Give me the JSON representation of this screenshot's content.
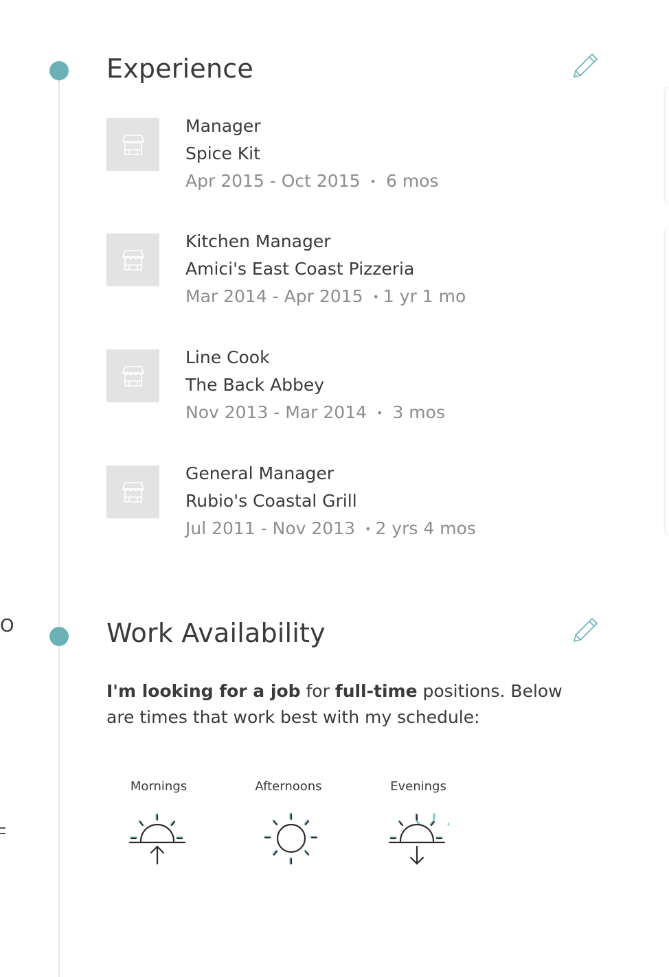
{
  "experience": {
    "title": "Experience",
    "edit_icon": "pencil-icon",
    "jobs": [
      {
        "title": "Manager",
        "company": "Spice Kit",
        "dates": "Apr 2015 - Oct 2015",
        "duration": "6 mos"
      },
      {
        "title": "Kitchen Manager",
        "company": "Amici's East Coast Pizzeria",
        "dates": "Mar 2014 - Apr 2015",
        "duration": "1 yr 1 mo"
      },
      {
        "title": "Line Cook",
        "company": "The Back Abbey",
        "dates": "Nov 2013 - Mar 2014",
        "duration": "3 mos"
      },
      {
        "title": "General Manager",
        "company": "Rubio's Coastal Grill",
        "dates": "Jul 2011 - Nov 2013",
        "duration": "2 yrs 4 mos"
      }
    ],
    "logo_icon": "storefront-icon"
  },
  "availability": {
    "title": "Work Availability",
    "edit_icon": "pencil-icon",
    "text_lead": "I'm looking for a job",
    "text_mid1": " for ",
    "text_type": "full-time",
    "text_rest": " positions. Below are times that work best with my schedule:",
    "slots": [
      {
        "label": "Mornings",
        "icon": "sunrise-icon"
      },
      {
        "label": "Afternoons",
        "icon": "sun-icon"
      },
      {
        "label": "Evenings",
        "icon": "sunset-icon"
      }
    ]
  },
  "edge": {
    "left_char": "O"
  },
  "colors": {
    "accent": "#6ab2b6",
    "text": "#3a3a3a",
    "muted": "#8d8d8d",
    "placeholder": "#e3e3e3"
  }
}
